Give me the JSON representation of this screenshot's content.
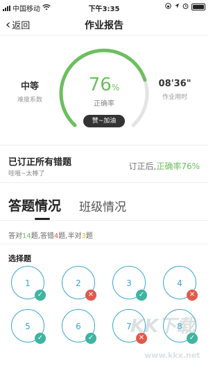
{
  "status_bar": {
    "carrier": "中国移动",
    "time": "下午3:35"
  },
  "nav": {
    "back_label": "返回",
    "title": "作业报告"
  },
  "stats": {
    "difficulty_value": "中等",
    "difficulty_label": "难度系数",
    "accuracy_value": "76",
    "accuracy_unit": "%",
    "accuracy_label": "正确率",
    "accuracy_fraction": 0.76,
    "time_value": "08'36\"",
    "time_label": "作业用时",
    "cheer_label": "赞~加油"
  },
  "fixed": {
    "title": "已订正所有错题",
    "subtitle": "哇哦~太棒了",
    "right_prefix": "订正后,",
    "right_value": "正确率76%"
  },
  "tabs": {
    "active": "答题情况",
    "other": "班级情况"
  },
  "summary": {
    "p1": "答对",
    "correct": "14",
    "p2": "题,答错",
    "wrong": "4",
    "p3": "题,半对",
    "half": "3",
    "p4": "题"
  },
  "section_title": "选择题",
  "questions": [
    {
      "num": "1",
      "status": "correct"
    },
    {
      "num": "2",
      "status": "wrong"
    },
    {
      "num": "3",
      "status": "correct"
    },
    {
      "num": "4",
      "status": "wrong"
    },
    {
      "num": "5",
      "status": "correct"
    },
    {
      "num": "6",
      "status": "correct"
    },
    {
      "num": "7",
      "status": "wrong"
    },
    {
      "num": "8",
      "status": "correct"
    }
  ],
  "watermark": {
    "text": "KK下载",
    "sub": "www.kkx.net"
  },
  "colors": {
    "green": "#6cbf5e",
    "blue": "#3aa5d4",
    "red": "#e05a4b",
    "yellow": "#e7b324"
  }
}
